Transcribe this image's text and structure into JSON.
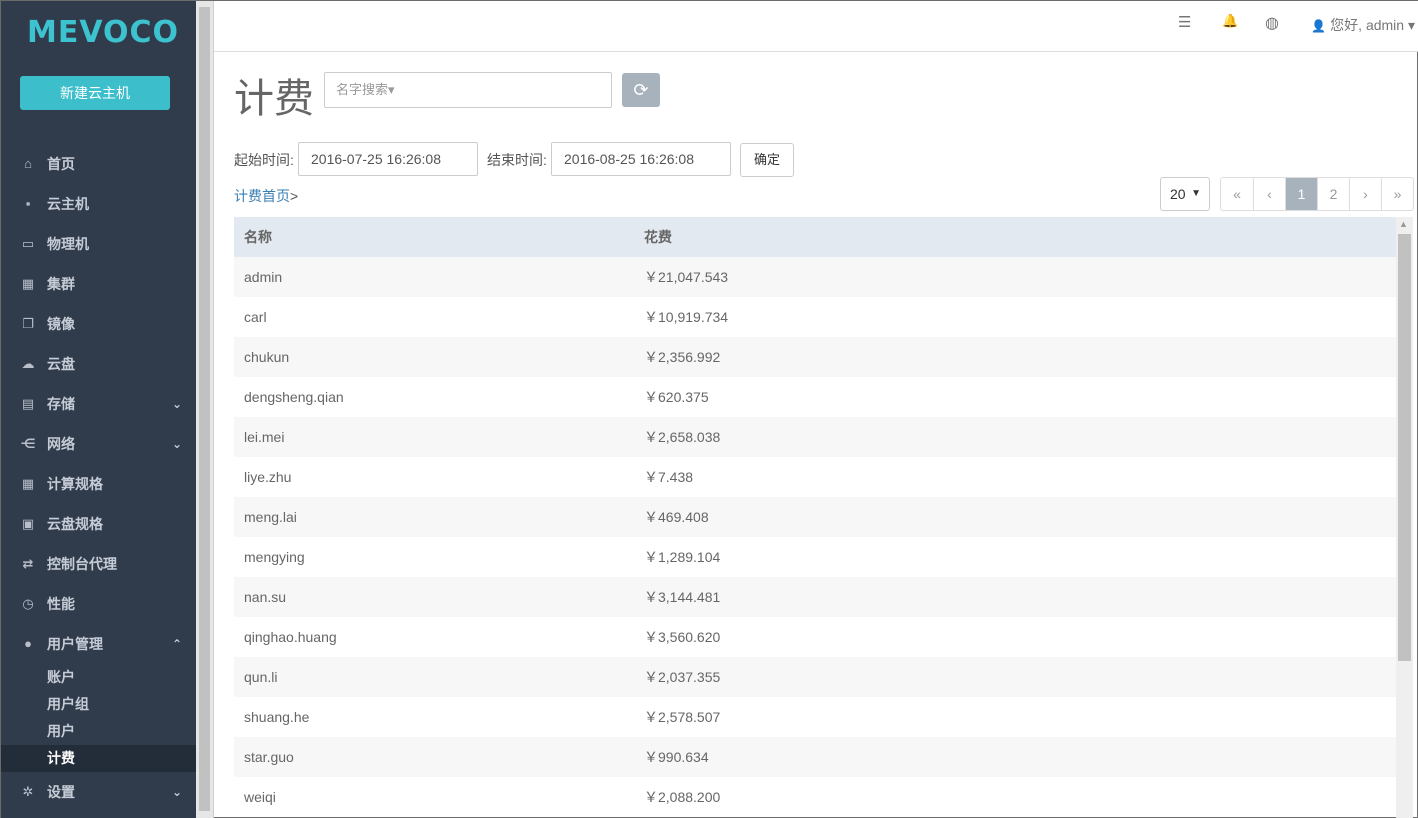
{
  "sidebar": {
    "logo": "MEVOCO",
    "new_vm": "新建云主机",
    "items": [
      {
        "label": "首页",
        "icon": "⌂",
        "chevron": ""
      },
      {
        "label": "云主机",
        "icon": "▪",
        "chevron": ""
      },
      {
        "label": "物理机",
        "icon": "▭",
        "chevron": ""
      },
      {
        "label": "集群",
        "icon": "▦",
        "chevron": ""
      },
      {
        "label": "镜像",
        "icon": "❐",
        "chevron": ""
      },
      {
        "label": "云盘",
        "icon": "☁",
        "chevron": ""
      },
      {
        "label": "存储",
        "icon": "▤",
        "chevron": "⌄"
      },
      {
        "label": "网络",
        "icon": "⋲",
        "chevron": "⌄"
      },
      {
        "label": "计算规格",
        "icon": "▦",
        "chevron": ""
      },
      {
        "label": "云盘规格",
        "icon": "▣",
        "chevron": ""
      },
      {
        "label": "控制台代理",
        "icon": "⇄",
        "chevron": ""
      },
      {
        "label": "性能",
        "icon": "◷",
        "chevron": ""
      },
      {
        "label": "用户管理",
        "icon": "●",
        "chevron": "⌃"
      }
    ],
    "subitems": [
      "账户",
      "用户组",
      "用户",
      "计费"
    ],
    "settings": {
      "label": "设置",
      "icon": "✲",
      "chevron": "⌄"
    }
  },
  "topbar": {
    "list_icon": "☰",
    "bell_icon": "🔔",
    "globe_icon": "◍",
    "user_icon": "👤",
    "user_text": "您好, admin ▾"
  },
  "page": {
    "title": "计费",
    "search_placeholder": "名字搜索▾",
    "refresh_icon": "⟳",
    "start_label": "起始时间:",
    "start_value": "2016-07-25 16:26:08",
    "end_label": "结束时间:",
    "end_value": "2016-08-25 16:26:08",
    "ok_label": "确定",
    "crumb_link": "计费首页",
    "crumb_sep": ">",
    "page_size": "20",
    "pager": [
      "«",
      "‹",
      "1",
      "2",
      "›",
      "»"
    ],
    "pager_active": "1"
  },
  "table": {
    "headers": [
      "名称",
      "花费"
    ],
    "rows": [
      [
        "admin",
        "￥21,047.543"
      ],
      [
        "carl",
        "￥10,919.734"
      ],
      [
        "chukun",
        "￥2,356.992"
      ],
      [
        "dengsheng.qian",
        "￥620.375"
      ],
      [
        "lei.mei",
        "￥2,658.038"
      ],
      [
        "liye.zhu",
        "￥7.438"
      ],
      [
        "meng.lai",
        "￥469.408"
      ],
      [
        "mengying",
        "￥1,289.104"
      ],
      [
        "nan.su",
        "￥3,144.481"
      ],
      [
        "qinghao.huang",
        "￥3,560.620"
      ],
      [
        "qun.li",
        "￥2,037.355"
      ],
      [
        "shuang.he",
        "￥2,578.507"
      ],
      [
        "star.guo",
        "￥990.634"
      ],
      [
        "weiqi",
        "￥2,088.200"
      ]
    ]
  }
}
